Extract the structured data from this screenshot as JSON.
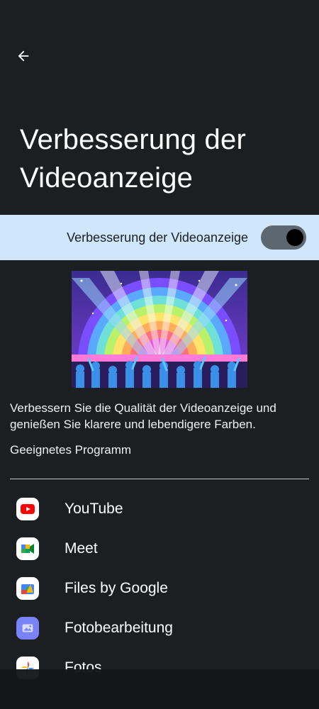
{
  "header": {
    "back_icon": "arrow-left-icon",
    "title": "Verbesserung der Videoanzeige"
  },
  "toggle": {
    "label": "Verbesserung der Videoanzeige",
    "state": "on"
  },
  "description": "Verbessern Sie die Qualität der Videoanzeige und genießen Sie klarere und lebendigere Farben.",
  "section_label": "Geeignetes Programm",
  "apps": [
    {
      "name": "YouTube",
      "icon": "youtube-icon"
    },
    {
      "name": "Meet",
      "icon": "meet-icon"
    },
    {
      "name": "Files by Google",
      "icon": "files-icon"
    },
    {
      "name": "Fotobearbeitung",
      "icon": "photo-edit-icon"
    },
    {
      "name": "Fotos",
      "icon": "photos-icon"
    }
  ],
  "colors": {
    "background": "#1c1f22",
    "toggle_row": "#cfe6fb",
    "switch_track": "#5d6770"
  }
}
